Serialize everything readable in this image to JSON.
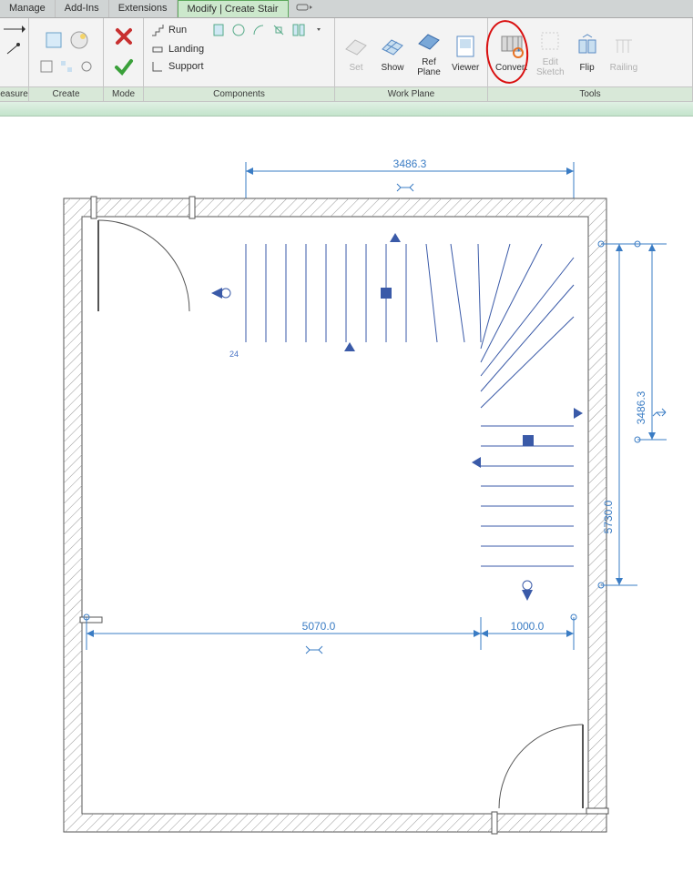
{
  "tabs": {
    "manage": "Manage",
    "addins": "Add-Ins",
    "extensions": "Extensions",
    "modify": "Modify | Create Stair"
  },
  "panels": {
    "measure": "easure",
    "create": "Create",
    "mode": "Mode",
    "components": "Components",
    "workplane": "Work Plane",
    "tools": "Tools"
  },
  "buttons": {
    "run": "Run",
    "landing": "Landing",
    "support": "Support",
    "set": "Set",
    "show": "Show",
    "refplane": "Ref\nPlane",
    "viewer": "Viewer",
    "convert": "Convert",
    "editsketch": "Edit\nSketch",
    "flip": "Flip",
    "railing": "Railing"
  },
  "drawing": {
    "dim_top": "3486.3",
    "dim_right_upper": "3486.3",
    "dim_right_full": "5730.0",
    "dim_bottom_main": "5070.0",
    "dim_bottom_right": "1000.0",
    "riser_count": "24"
  }
}
